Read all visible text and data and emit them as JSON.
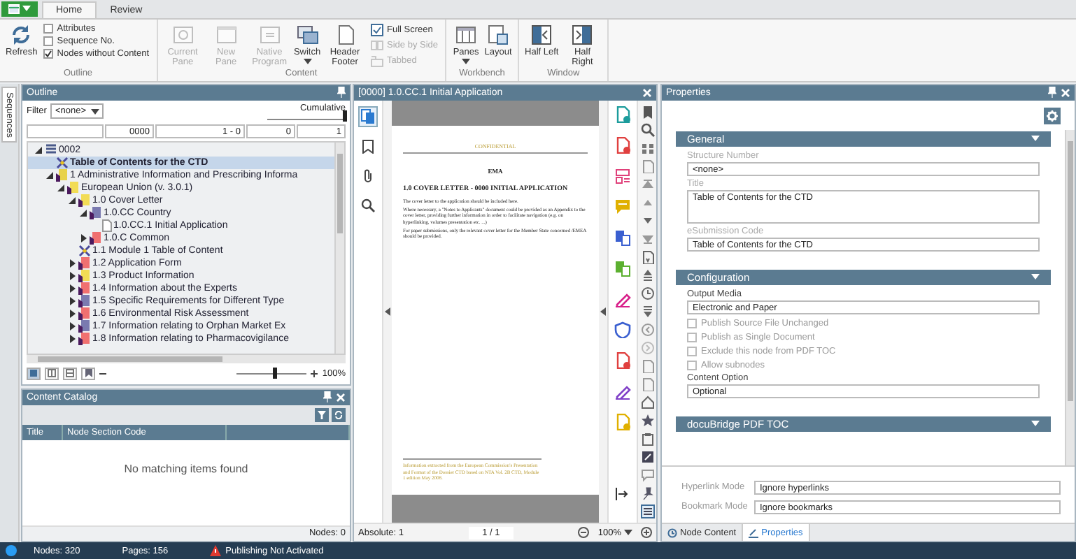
{
  "ribbon": {
    "tabs": [
      {
        "label": "Home",
        "selected": true
      },
      {
        "label": "Review",
        "selected": false
      }
    ],
    "groups": [
      {
        "label": "Outline",
        "items": [
          {
            "kind": "large",
            "label": "Refresh",
            "disabled": false
          },
          {
            "kind": "check",
            "label": "Attributes",
            "checked": false
          },
          {
            "kind": "check",
            "label": "Sequence No.",
            "checked": false
          },
          {
            "kind": "check",
            "label": "Nodes without Content",
            "checked": true
          }
        ]
      },
      {
        "label": "Content",
        "items": [
          {
            "kind": "large",
            "label": "Current Pane",
            "disabled": true
          },
          {
            "kind": "large",
            "label": "New Pane",
            "disabled": true
          },
          {
            "kind": "large",
            "label": "Native Program",
            "disabled": true
          },
          {
            "kind": "large",
            "label": "Switch",
            "disabled": false,
            "dropdown": true
          },
          {
            "kind": "large",
            "label": "Header Footer",
            "disabled": false
          },
          {
            "kind": "small",
            "label": "Full Screen",
            "disabled": false
          },
          {
            "kind": "small",
            "label": "Side by Side",
            "disabled": true
          },
          {
            "kind": "small",
            "label": "Tabbed",
            "disabled": true
          }
        ]
      },
      {
        "label": "Workbench",
        "items": [
          {
            "kind": "large",
            "label": "Panes",
            "disabled": false,
            "dropdown": true
          },
          {
            "kind": "large",
            "label": "Layout",
            "disabled": false
          }
        ]
      },
      {
        "label": "Window",
        "items": [
          {
            "kind": "large",
            "label": "Half Left",
            "disabled": false
          },
          {
            "kind": "large",
            "label": "Half Right",
            "disabled": false
          }
        ]
      }
    ]
  },
  "sidebar": {
    "tabs": [
      {
        "label": "Sequences",
        "selected": true
      }
    ]
  },
  "outline": {
    "title": "Outline",
    "filter_label": "Filter",
    "filter_value": "<none>",
    "slider_label": "Cumulative",
    "slider": {
      "level": 1
    },
    "fields": [
      "0000",
      "1 - 0",
      "0",
      "1"
    ],
    "tree": [
      {
        "kind": "root",
        "label": "0002",
        "expanded": true,
        "selected": false,
        "children": [
          {
            "kind": "toc",
            "label": "Table of Contents for the CTD",
            "selected": true
          },
          {
            "kind": "folder",
            "label": "1 Administrative Information and Prescribing Informa",
            "color": "#e8d24a",
            "expanded": true,
            "selected": false,
            "children": [
              {
                "kind": "folder",
                "label": "European Union (v. 3.0.1)",
                "color": "#f2dc55",
                "expanded": true,
                "selected": false,
                "children": [
                  {
                    "kind": "folder",
                    "label": "1.0 Cover Letter",
                    "color": "#f2dc55",
                    "expanded": true,
                    "selected": false,
                    "children": [
                      {
                        "kind": "folder",
                        "label": "1.0.CC Country",
                        "color": "#7a7ab0",
                        "expanded": true,
                        "selected": false,
                        "children": [
                          {
                            "kind": "document",
                            "label": "1.0.CC.1 Initial Application",
                            "selected": false
                          }
                        ]
                      },
                      {
                        "kind": "folder",
                        "label": "1.0.C Common",
                        "color": "#f07070",
                        "expanded": false,
                        "selected": false
                      }
                    ]
                  },
                  {
                    "kind": "toc",
                    "label": "1.1 Module 1 Table of Content",
                    "selected": false
                  },
                  {
                    "kind": "folder",
                    "label": "1.2 Application Form",
                    "color": "#f07070",
                    "expanded": false,
                    "selected": false
                  },
                  {
                    "kind": "folder",
                    "label": "1.3 Product Information",
                    "color": "#f2dc55",
                    "expanded": false,
                    "selected": false
                  },
                  {
                    "kind": "folder",
                    "label": "1.4 Information about the Experts",
                    "color": "#f07070",
                    "expanded": false,
                    "selected": false
                  },
                  {
                    "kind": "folder",
                    "label": "1.5 Specific Requirements for Different Type",
                    "color": "#7a7ab0",
                    "expanded": false,
                    "selected": false
                  },
                  {
                    "kind": "folder",
                    "label": "1.6 Environmental Risk Assessment",
                    "color": "#f07070",
                    "expanded": false,
                    "selected": false
                  },
                  {
                    "kind": "folder",
                    "label": "1.7 Information relating to Orphan Market Ex",
                    "color": "#7a7ab0",
                    "expanded": false,
                    "selected": false
                  },
                  {
                    "kind": "folder",
                    "label": "1.8 Information relating to Pharmacovigilance",
                    "color": "#f07070",
                    "expanded": false,
                    "selected": false
                  }
                ]
              }
            ]
          }
        ]
      }
    ],
    "zoom": {
      "level": 0.55
    },
    "zoom_reading": "100%"
  },
  "content_catalog": {
    "title": "Content Catalog",
    "columns": [
      "Title",
      "Node Section Code"
    ],
    "empty_message": "No matching items found",
    "footer": "Nodes: 0"
  },
  "document": {
    "title": "[0000] 1.0.CC.1 Initial Application",
    "page": {
      "header": "CONFIDENTIAL",
      "agency": "EMA",
      "heading": "1.0 COVER LETTER - 0000 INITIAL APPLICATION",
      "paragraphs": [
        "The cover letter to the application should be included here.",
        "Where necessary, a \"Notes to Applicants\" document could be provided as an Appendix to the cover letter, providing further information in order to facilitate navigation (e.g. on hyperlinking, volumes presentation etc. ...)",
        "For paper submissions, only the relevant cover letter for the Member State concerned /EMEA should be provided."
      ],
      "footer": "Information extracted from the European Commission's Presentation and Format of the Dossier CTD based on NTA Vol. 2B CTD, Module 1 edition May 2008."
    },
    "position": "Absolute: 1",
    "page_count": "1 / 1",
    "zoom": "100%"
  },
  "properties": {
    "title": "Properties",
    "sections": [
      {
        "title": "General",
        "items": [
          {
            "kind": "field",
            "label": "Structure Number",
            "value": "<none>",
            "disabled": true
          },
          {
            "kind": "area",
            "label": "Title",
            "value": "Table of Contents for the CTD",
            "disabled": true
          },
          {
            "kind": "field",
            "label": "eSubmission Code",
            "value": "Table of Contents for the CTD",
            "disabled": true
          }
        ]
      },
      {
        "title": "Configuration",
        "items": [
          {
            "kind": "field",
            "label": "Output Media",
            "value": "Electronic and Paper",
            "disabled": false
          },
          {
            "kind": "check",
            "label": "Publish Source File Unchanged",
            "checked": false,
            "disabled": true
          },
          {
            "kind": "check",
            "label": "Publish as Single Document",
            "checked": false,
            "disabled": true
          },
          {
            "kind": "check",
            "label": "Exclude this node from PDF TOC",
            "checked": false,
            "disabled": true
          },
          {
            "kind": "check",
            "label": "Allow subnodes",
            "checked": false,
            "disabled": true
          },
          {
            "kind": "field",
            "label": "Content Option",
            "value": "Optional",
            "disabled": false
          }
        ]
      },
      {
        "title": "docuBridge PDF TOC"
      }
    ],
    "modes": [
      {
        "label": "Hyperlink Mode",
        "value": "Ignore hyperlinks"
      },
      {
        "label": "Bookmark Mode",
        "value": "Ignore bookmarks"
      }
    ],
    "tabs": [
      {
        "label": "Node Content",
        "selected": false
      },
      {
        "label": "Properties",
        "selected": true
      }
    ]
  },
  "status_bar": {
    "nodes": "Nodes: 320",
    "pages": "Pages: 156",
    "publishing": "Publishing Not Activated"
  }
}
